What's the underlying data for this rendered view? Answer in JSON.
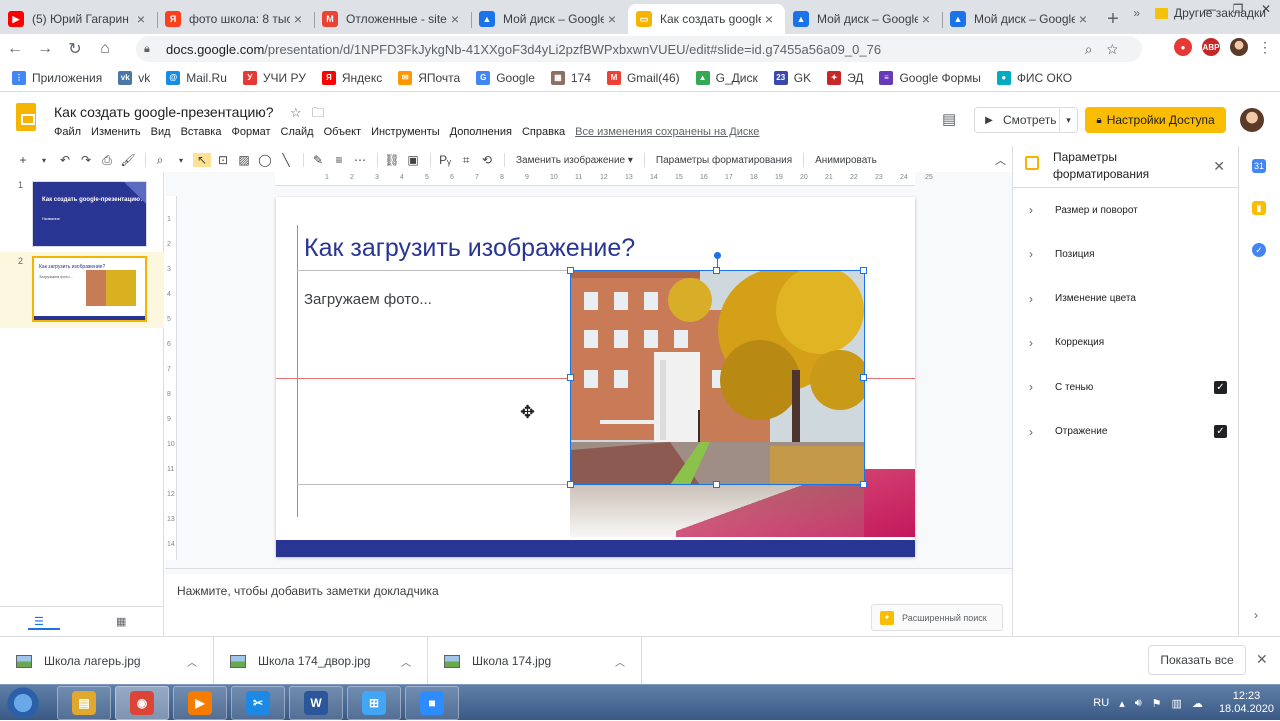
{
  "browser": {
    "tabs": [
      {
        "label": "(5) Юрий Гагарин",
        "icon": "youtube-icon",
        "color": "#ff0000",
        "glyph": "▶"
      },
      {
        "label": "фото школа: 8 тыс",
        "icon": "yandex-images-icon",
        "color": "#fc3f1d",
        "glyph": "Я"
      },
      {
        "label": "Отложенные - site",
        "icon": "gmail-icon",
        "color": "#ea4335",
        "glyph": "M"
      },
      {
        "label": "Мой диск – Google",
        "icon": "google-drive-icon",
        "color": "#1a73e8",
        "glyph": "▲"
      },
      {
        "label": "Как создать google",
        "icon": "google-slides-icon",
        "color": "#f4b400",
        "glyph": "▭",
        "active": true
      },
      {
        "label": "Мой диск – Google",
        "icon": "google-drive-icon",
        "color": "#1a73e8",
        "glyph": "▲"
      },
      {
        "label": "Мой диск – Google",
        "icon": "google-drive-icon",
        "color": "#1a73e8",
        "glyph": "▲"
      }
    ],
    "url_host": "docs.google.com",
    "url_path": "/presentation/d/1NPFD3FkJykgNb-41XXgoF3d4yLi2pzfBWPxbxwnVUEU/edit#slide=id.g7455a56a09_0_76",
    "bookmarks": [
      {
        "label": "Приложения",
        "color": "#4285f4",
        "glyph": "⋮"
      },
      {
        "label": "vk",
        "color": "#4a76a8",
        "glyph": "vk"
      },
      {
        "label": "Mail.Ru",
        "color": "#168de2",
        "glyph": "@"
      },
      {
        "label": "УЧИ РУ",
        "color": "#e53935",
        "glyph": "У"
      },
      {
        "label": "Яндекс",
        "color": "#ff0000",
        "glyph": "Я"
      },
      {
        "label": "ЯПочта",
        "color": "#ff9800",
        "glyph": "✉"
      },
      {
        "label": "Google",
        "color": "#4285f4",
        "glyph": "G"
      },
      {
        "label": "174",
        "color": "#8d6e63",
        "glyph": "▦"
      },
      {
        "label": "Gmail(46)",
        "color": "#ea4335",
        "glyph": "M"
      },
      {
        "label": "G_Диск",
        "color": "#34a853",
        "glyph": "▲"
      },
      {
        "label": "GK",
        "color": "#3949ab",
        "glyph": "23"
      },
      {
        "label": "ЭД",
        "color": "#c62828",
        "glyph": "✦"
      },
      {
        "label": "Google Формы",
        "color": "#673ab7",
        "glyph": "≡"
      },
      {
        "label": "ФИС ОКО",
        "color": "#00acc1",
        "glyph": "●"
      }
    ],
    "bookmarks_more": "»",
    "other_bookmarks": "Другие закладки"
  },
  "docs": {
    "title": "Как создать google-презентацию?",
    "menu": [
      "Файл",
      "Изменить",
      "Вид",
      "Вставка",
      "Формат",
      "Слайд",
      "Объект",
      "Инструменты",
      "Дополнения",
      "Справка"
    ],
    "saved_status": "Все изменения сохранены на Диске",
    "present_label": "Смотреть",
    "share_label": "Настройки Доступа",
    "share_icon": "lock-icon"
  },
  "toolbar": {
    "replace_image": "Заменить изображение ▾",
    "format_options": "Параметры форматирования",
    "animate": "Анимировать"
  },
  "filmstrip": {
    "slides": [
      {
        "num": "1",
        "title": "Как создать google-презентацию?",
        "subtitle": "Название"
      },
      {
        "num": "2",
        "title": "Как загрузить изображение?",
        "subtitle": "Загружаем фото..."
      }
    ]
  },
  "ruler": {
    "h_ticks": [
      "1",
      "2",
      "3",
      "4",
      "5",
      "6",
      "7",
      "8",
      "9",
      "10",
      "11",
      "12",
      "13",
      "14",
      "15",
      "16",
      "17",
      "18",
      "19",
      "20",
      "21",
      "22",
      "23",
      "24",
      "25"
    ],
    "v_ticks": [
      "1",
      "2",
      "3",
      "4",
      "5",
      "6",
      "7",
      "8",
      "9",
      "10",
      "11",
      "12",
      "13",
      "14"
    ]
  },
  "slide": {
    "title": "Как загрузить изображение?",
    "body": "Загружаем фото..."
  },
  "notes": {
    "placeholder": "Нажмите, чтобы добавить заметки докладчика",
    "explore_label": "Расширенный поиск"
  },
  "format_panel": {
    "title": "Параметры форматирования",
    "sections": [
      {
        "label": "Размер и поворот",
        "checked": false
      },
      {
        "label": "Позиция",
        "checked": false
      },
      {
        "label": "Изменение цвета",
        "checked": false
      },
      {
        "label": "Коррекция",
        "checked": false
      },
      {
        "label": "С тенью",
        "checked": true
      },
      {
        "label": "Отражение",
        "checked": true
      }
    ]
  },
  "downloads": {
    "items": [
      "Школа лагерь.jpg",
      "Школа 174_двор.jpg",
      "Школа 174.jpg"
    ],
    "show_all": "Показать все"
  },
  "taskbar": {
    "apps": [
      {
        "name": "explorer",
        "color": "#e0a82e",
        "glyph": "▤"
      },
      {
        "name": "chrome",
        "color": "#db4437",
        "glyph": "◉",
        "active": true
      },
      {
        "name": "media-player",
        "color": "#f57c00",
        "glyph": "▶"
      },
      {
        "name": "snipping",
        "color": "#1e88e5",
        "glyph": "✂"
      },
      {
        "name": "word",
        "color": "#2b579a",
        "glyph": "W"
      },
      {
        "name": "network",
        "color": "#42a5f5",
        "glyph": "⊞"
      },
      {
        "name": "zoom",
        "color": "#2d8cff",
        "glyph": "■"
      }
    ],
    "lang": "RU",
    "time": "12:23",
    "date": "18.04.2020"
  }
}
